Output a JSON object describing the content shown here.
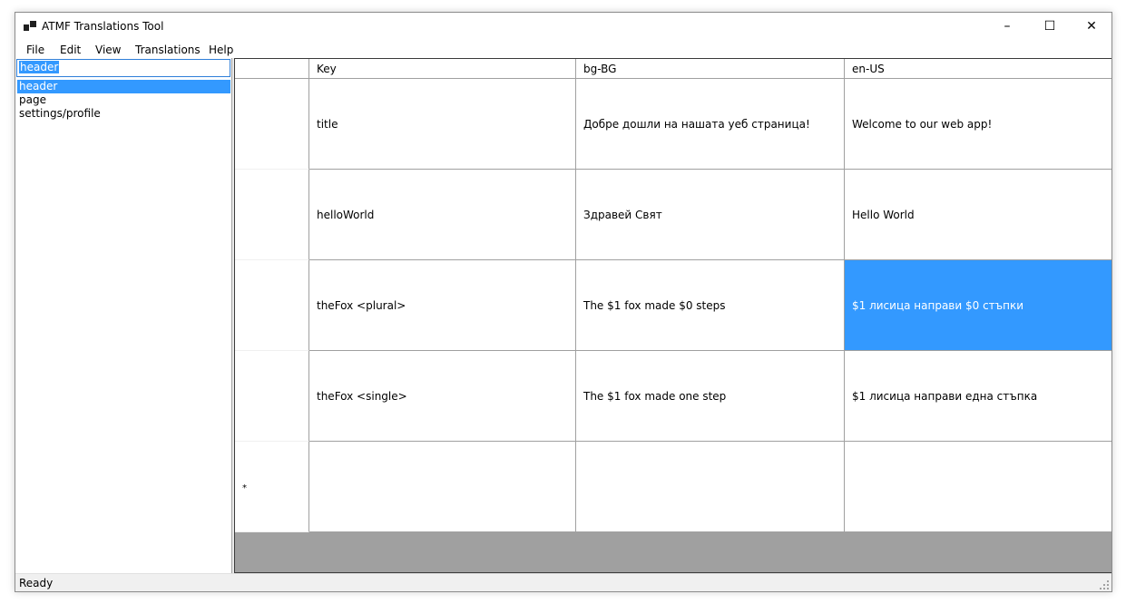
{
  "window": {
    "title": "ATMF Translations Tool",
    "minimize": "–",
    "maximize": "☐",
    "close": "✕"
  },
  "menu": [
    "File",
    "Edit",
    "View",
    "Translations",
    "Help"
  ],
  "sidebar": {
    "search_value": "header",
    "items": [
      {
        "label": "header",
        "selected": true
      },
      {
        "label": "page",
        "selected": false
      },
      {
        "label": "settings/profile",
        "selected": false
      }
    ]
  },
  "grid": {
    "columns": [
      "Key",
      "bg-BG",
      "en-US"
    ],
    "rows": [
      {
        "key": "title",
        "bg": "Добре дошли на нашата уеб страница!",
        "en": "Welcome to our web app!"
      },
      {
        "key": "helloWorld",
        "bg": "Здравей Свят",
        "en": "Hello World"
      },
      {
        "key": "theFox <plural>",
        "bg": "The $1 fox made $0 steps",
        "en": "$1 лисица направи $0 стъпки"
      },
      {
        "key": "theFox <single>",
        "bg": "The $1 fox made one step",
        "en": "$1 лисица направи една стъпка"
      }
    ],
    "new_row_marker": "*",
    "selected_cell": {
      "row": 2,
      "column": "en-US"
    }
  },
  "status": "Ready",
  "colors": {
    "selection": "#3399ff",
    "grid_background": "#a0a0a0",
    "gridline": "#a0a0a0"
  }
}
